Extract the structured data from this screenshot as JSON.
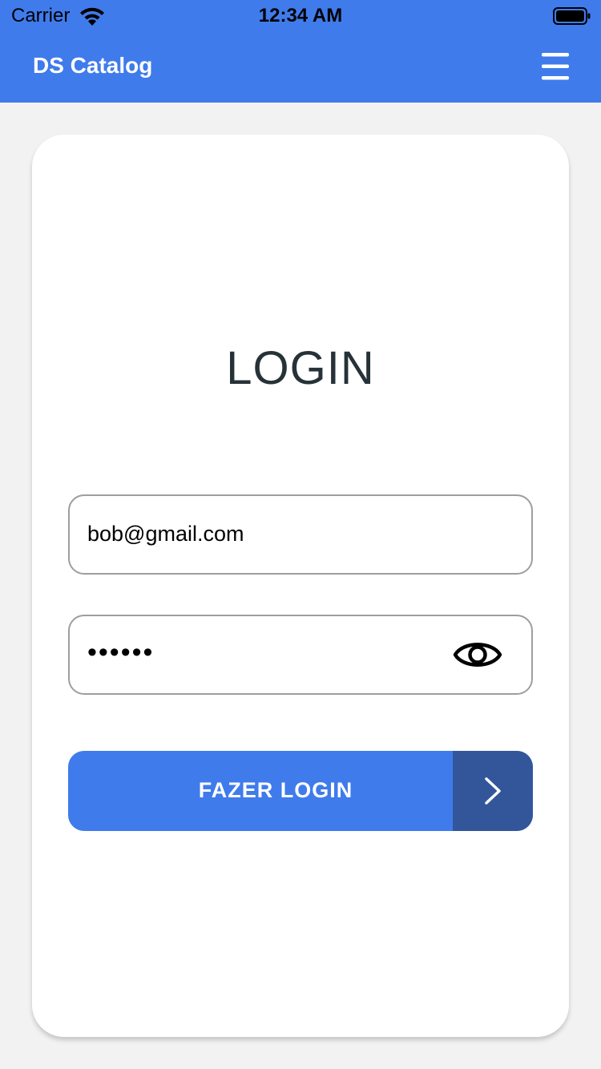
{
  "status_bar": {
    "carrier": "Carrier",
    "time": "12:34 AM",
    "wifi_icon": "wifi-icon",
    "battery_icon": "battery-icon"
  },
  "header": {
    "title": "DS Catalog",
    "menu_icon": "menu-icon",
    "color": "#407bec"
  },
  "login": {
    "title": "LOGIN",
    "email_value": "bob@gmail.com",
    "password_value": "••••••",
    "eye_icon": "eye-icon",
    "submit_label": "FAZER LOGIN",
    "submit_icon": "chevron-right-icon",
    "button_color": "#407bec",
    "arrow_color": "#33569b"
  }
}
